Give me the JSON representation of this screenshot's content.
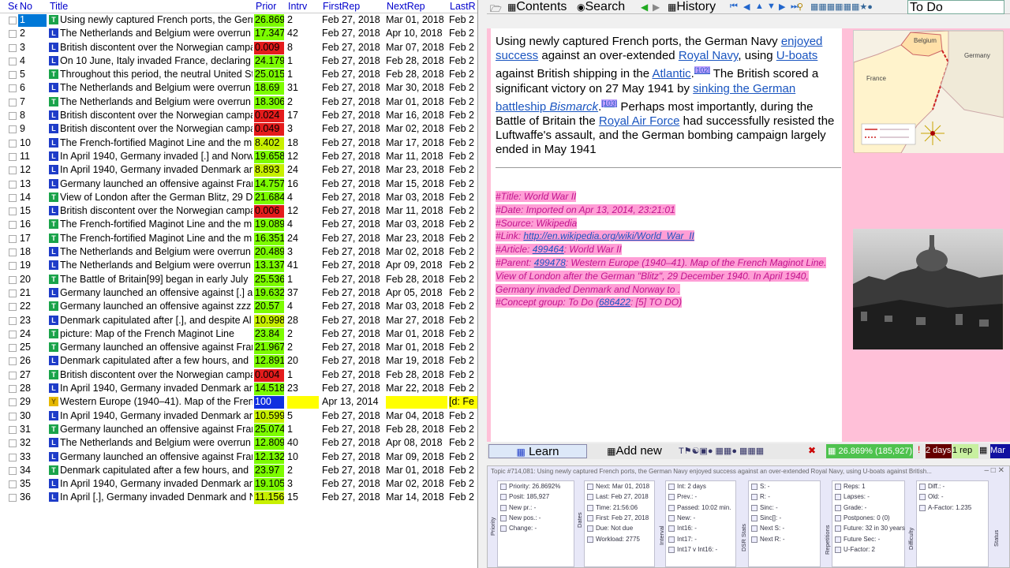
{
  "list": {
    "headers": {
      "sel": "Se",
      "no": "No",
      "title": "Title",
      "prior": "Prior",
      "intrv": "Intrv",
      "first": "FirstRep",
      "next": "NextRep",
      "last": "LastR"
    },
    "rows": [
      {
        "no": "1",
        "icon": "T",
        "title": "Using newly captured French ports, the German",
        "prior": "26.869",
        "pc": "green",
        "intrv": "2",
        "first": "Feb 27, 2018",
        "next": "Mar 01, 2018",
        "last": "Feb 2"
      },
      {
        "no": "2",
        "icon": "L",
        "title": "The Netherlands and Belgium were overrun",
        "prior": "17.347",
        "pc": "green",
        "intrv": "42",
        "first": "Feb 27, 2018",
        "next": "Apr 10, 2018",
        "last": "Feb 2"
      },
      {
        "no": "3",
        "icon": "L",
        "title": "British discontent over the Norwegian campaign",
        "prior": "0.009",
        "pc": "red",
        "intrv": "8",
        "first": "Feb 27, 2018",
        "next": "Mar 07, 2018",
        "last": "Feb 2"
      },
      {
        "no": "4",
        "icon": "L",
        "title": "On 10 June, Italy invaded France, declaring",
        "prior": "24.179",
        "pc": "green",
        "intrv": "1",
        "first": "Feb 27, 2018",
        "next": "Feb 28, 2018",
        "last": "Feb 2"
      },
      {
        "no": "5",
        "icon": "T",
        "title": "Throughout this period, the neutral United States",
        "prior": "25.015",
        "pc": "green",
        "intrv": "1",
        "first": "Feb 27, 2018",
        "next": "Feb 28, 2018",
        "last": "Feb 2"
      },
      {
        "no": "6",
        "icon": "L",
        "title": "The Netherlands and Belgium were overrun",
        "prior": "18.69",
        "pc": "green",
        "intrv": "31",
        "first": "Feb 27, 2018",
        "next": "Mar 30, 2018",
        "last": "Feb 2"
      },
      {
        "no": "7",
        "icon": "T",
        "title": "The Netherlands and Belgium were overrun",
        "prior": "18.306",
        "pc": "green",
        "intrv": "2",
        "first": "Feb 27, 2018",
        "next": "Mar 01, 2018",
        "last": "Feb 2"
      },
      {
        "no": "8",
        "icon": "L",
        "title": "British discontent over the Norwegian campaign",
        "prior": "0.024",
        "pc": "red",
        "intrv": "17",
        "first": "Feb 27, 2018",
        "next": "Mar 16, 2018",
        "last": "Feb 2"
      },
      {
        "no": "9",
        "icon": "L",
        "title": "British discontent over the Norwegian campaign",
        "prior": "0.049",
        "pc": "red",
        "intrv": "3",
        "first": "Feb 27, 2018",
        "next": "Mar 02, 2018",
        "last": "Feb 2"
      },
      {
        "no": "10",
        "icon": "L",
        "title": "The French-fortified Maginot Line and the m",
        "prior": "8.402",
        "pc": "ygreen",
        "intrv": "18",
        "first": "Feb 27, 2018",
        "next": "Mar 17, 2018",
        "last": "Feb 2"
      },
      {
        "no": "11",
        "icon": "L",
        "title": "In April 1940, Germany invaded [.] and Norway",
        "prior": "19.658",
        "pc": "green",
        "intrv": "12",
        "first": "Feb 27, 2018",
        "next": "Mar 11, 2018",
        "last": "Feb 2"
      },
      {
        "no": "12",
        "icon": "L",
        "title": "In April 1940, Germany invaded Denmark and",
        "prior": "8.893",
        "pc": "ygreen",
        "intrv": "24",
        "first": "Feb 27, 2018",
        "next": "Mar 23, 2018",
        "last": "Feb 2"
      },
      {
        "no": "13",
        "icon": "L",
        "title": "Germany launched an offensive against France",
        "prior": "14.757",
        "pc": "green",
        "intrv": "16",
        "first": "Feb 27, 2018",
        "next": "Mar 15, 2018",
        "last": "Feb 2"
      },
      {
        "no": "14",
        "icon": "T",
        "title": "View of London after the German Blitz, 29 D",
        "prior": "21.684",
        "pc": "green",
        "intrv": "4",
        "first": "Feb 27, 2018",
        "next": "Mar 03, 2018",
        "last": "Feb 2"
      },
      {
        "no": "15",
        "icon": "L",
        "title": "British discontent over the Norwegian campaign",
        "prior": "0.006",
        "pc": "red",
        "intrv": "12",
        "first": "Feb 27, 2018",
        "next": "Mar 11, 2018",
        "last": "Feb 2"
      },
      {
        "no": "16",
        "icon": "T",
        "title": "The French-fortified Maginot Line and the m",
        "prior": "19.089",
        "pc": "green",
        "intrv": "4",
        "first": "Feb 27, 2018",
        "next": "Mar 03, 2018",
        "last": "Feb 2"
      },
      {
        "no": "17",
        "icon": "T",
        "title": "The French-fortified Maginot Line and the m",
        "prior": "16.351",
        "pc": "green",
        "intrv": "24",
        "first": "Feb 27, 2018",
        "next": "Mar 23, 2018",
        "last": "Feb 2"
      },
      {
        "no": "18",
        "icon": "L",
        "title": "The Netherlands and Belgium were overrun",
        "prior": "20.489",
        "pc": "green",
        "intrv": "3",
        "first": "Feb 27, 2018",
        "next": "Mar 02, 2018",
        "last": "Feb 2"
      },
      {
        "no": "19",
        "icon": "L",
        "title": "The Netherlands and Belgium were overrun",
        "prior": "13.137",
        "pc": "green",
        "intrv": "41",
        "first": "Feb 27, 2018",
        "next": "Apr 09, 2018",
        "last": "Feb 2"
      },
      {
        "no": "20",
        "icon": "T",
        "title": "The Battle of Britain[99] began in early July",
        "prior": "25.536",
        "pc": "green",
        "intrv": "1",
        "first": "Feb 27, 2018",
        "next": "Feb 28, 2018",
        "last": "Feb 2"
      },
      {
        "no": "21",
        "icon": "L",
        "title": "Germany launched an offensive against [.] a",
        "prior": "19.632",
        "pc": "green",
        "intrv": "37",
        "first": "Feb 27, 2018",
        "next": "Apr 05, 2018",
        "last": "Feb 2"
      },
      {
        "no": "22",
        "icon": "T",
        "title": "Germany launched an offensive against zzz",
        "prior": "20.57",
        "pc": "green",
        "intrv": "4",
        "first": "Feb 27, 2018",
        "next": "Mar 03, 2018",
        "last": "Feb 2"
      },
      {
        "no": "23",
        "icon": "L",
        "title": "Denmark capitulated after [.], and despite Al",
        "prior": "10.998",
        "pc": "ygreen",
        "intrv": "28",
        "first": "Feb 27, 2018",
        "next": "Mar 27, 2018",
        "last": "Feb 2"
      },
      {
        "no": "24",
        "icon": "T",
        "title": "picture: Map of the French Maginot Line",
        "prior": "23.84",
        "pc": "green",
        "intrv": "2",
        "first": "Feb 27, 2018",
        "next": "Mar 01, 2018",
        "last": "Feb 2"
      },
      {
        "no": "25",
        "icon": "T",
        "title": "Germany launched an offensive against France",
        "prior": "21.967",
        "pc": "green",
        "intrv": "2",
        "first": "Feb 27, 2018",
        "next": "Mar 01, 2018",
        "last": "Feb 2"
      },
      {
        "no": "26",
        "icon": "L",
        "title": "Denmark capitulated after a few hours, and",
        "prior": "12.891",
        "pc": "green",
        "intrv": "20",
        "first": "Feb 27, 2018",
        "next": "Mar 19, 2018",
        "last": "Feb 2"
      },
      {
        "no": "27",
        "icon": "T",
        "title": "British discontent over the Norwegian campaign",
        "prior": "0.004",
        "pc": "red",
        "intrv": "1",
        "first": "Feb 27, 2018",
        "next": "Feb 28, 2018",
        "last": "Feb 2"
      },
      {
        "no": "28",
        "icon": "L",
        "title": "In April 1940, Germany invaded Denmark and",
        "prior": "14.518",
        "pc": "green",
        "intrv": "23",
        "first": "Feb 27, 2018",
        "next": "Mar 22, 2018",
        "last": "Feb 2"
      },
      {
        "no": "29",
        "icon": "Y",
        "title": "Western Europe (1940–41). Map of the French",
        "prior": "100",
        "pc": "blue",
        "intrv": "",
        "first": "Apr 13, 2014",
        "next": "",
        "last": "[d: Fe"
      },
      {
        "no": "30",
        "icon": "L",
        "title": "In April 1940, Germany invaded Denmark and",
        "prior": "10.599",
        "pc": "ygreen",
        "intrv": "5",
        "first": "Feb 27, 2018",
        "next": "Mar 04, 2018",
        "last": "Feb 2"
      },
      {
        "no": "31",
        "icon": "T",
        "title": "Germany launched an offensive against France",
        "prior": "25.074",
        "pc": "green",
        "intrv": "1",
        "first": "Feb 27, 2018",
        "next": "Feb 28, 2018",
        "last": "Feb 2"
      },
      {
        "no": "32",
        "icon": "L",
        "title": "The Netherlands and Belgium were overrun",
        "prior": "12.809",
        "pc": "green",
        "intrv": "40",
        "first": "Feb 27, 2018",
        "next": "Apr 08, 2018",
        "last": "Feb 2"
      },
      {
        "no": "33",
        "icon": "L",
        "title": "Germany launched an offensive against France",
        "prior": "12.132",
        "pc": "green",
        "intrv": "10",
        "first": "Feb 27, 2018",
        "next": "Mar 09, 2018",
        "last": "Feb 2"
      },
      {
        "no": "34",
        "icon": "T",
        "title": "Denmark capitulated after a few hours, and",
        "prior": "23.97",
        "pc": "green",
        "intrv": "2",
        "first": "Feb 27, 2018",
        "next": "Mar 01, 2018",
        "last": "Feb 2"
      },
      {
        "no": "35",
        "icon": "L",
        "title": "In April 1940, Germany invaded Denmark and",
        "prior": "19.105",
        "pc": "green",
        "intrv": "3",
        "first": "Feb 27, 2018",
        "next": "Mar 02, 2018",
        "last": "Feb 2"
      },
      {
        "no": "36",
        "icon": "L",
        "title": "In April [.], Germany invaded Denmark and N",
        "prior": "11.156",
        "pc": "ygreen",
        "intrv": "15",
        "first": "Feb 27, 2018",
        "next": "Mar 14, 2018",
        "last": "Feb 2"
      }
    ]
  },
  "toolbar": {
    "contents": "Contents",
    "search": "Search",
    "history": "History",
    "todo": "To Do"
  },
  "article": {
    "p1": "Using newly captured French ports, the German Navy ",
    "l1": "enjoyed success",
    "p2": " against an over-extended ",
    "l2": "Royal Navy",
    "p3": ", using ",
    "l3": "U-boats",
    "p4": " against British shipping in the ",
    "l4": "Atlantic",
    "r1": "[102]",
    "p5": " The British scored a significant victory on 27 May 1941 by ",
    "l5": "sinking the German battleship ",
    "l5b": "Bismarck",
    "r2": "[103]",
    "p6": " Perhaps most importantly, during the Battle of Britain the ",
    "l6": "Royal Air Force",
    "p7": " had successfully resisted the Luftwaffe's assault, and the German bombing campaign largely ended in May 1941"
  },
  "meta": {
    "title": "#Title: World War II",
    "date": "#Date: Imported on Apr 13, 2014, 23:21:01",
    "source": "#Source: Wikipedia",
    "link_label": "#Link: ",
    "link": "http://en.wikipedia.org/wiki/World_War_II",
    "article_label": "#Article: ",
    "article_id": "499464",
    "article_rest": ": World War II",
    "parent_label": "#Parent: ",
    "parent_id": "499478",
    "parent_rest": ": Western Europe (1940–41). Map of the French Maginot Line.",
    "parent_rest2": "View of London after the German \"Blitz\", 29 December 1940. In April 1940,",
    "parent_rest3": "Germany invaded Denmark and Norway to .",
    "concept_label": "#Concept group: To Do (",
    "concept_id": "686422",
    "concept_rest": ": [5] TO DO)"
  },
  "map": {
    "belgium": "Belgium",
    "france": "France",
    "germany": "Germany"
  },
  "learnbar": {
    "learn": "Learn",
    "addnew": "Add new",
    "priority": "26.869% (185,927)",
    "days": "2 days",
    "rep": "1 rep",
    "mar": "Mar"
  },
  "stats": {
    "title": "Topic #714,081: Using newly captured French ports, the German Navy enjoyed success against an over-extended Royal Navy, using U-boats against British...",
    "priority": [
      "Priority: 26.8692%",
      "Posit: 185,927",
      "New pr.: -",
      "New pos.: -",
      "Change: -"
    ],
    "dates": [
      "Next: Mar 01, 2018",
      "Last: Feb 27, 2018",
      "Time: 21:56:06",
      "First: Feb 27, 2018",
      "Due: Not due",
      "Workload: 2775"
    ],
    "interval": [
      "Int: 2 days",
      "Prev.: -",
      "Passed: 10:02 min.",
      "New: -",
      "Int16: -",
      "Int17: -",
      "Int17 v Int16: -"
    ],
    "dsr": [
      "S: -",
      "R: -",
      "Sinc: -",
      "Sinc[]: -",
      "Next S: -",
      "Next R: -"
    ],
    "reps": [
      "Reps: 1",
      "Lapses: -",
      "Grade: -",
      "Postpones: 0 (0)",
      "Future: 32 in 30 years",
      "Future Sec: -",
      "U-Factor: 2"
    ],
    "diff": [
      "Diff.: -",
      "Old: -",
      "A-Factor: 1.235"
    ],
    "vlabels": {
      "priority": "Priority",
      "dates": "Dates",
      "interval": "Interval",
      "dsr": "DSR Stats",
      "reps": "Repetitions",
      "diff": "Difficulty",
      "status": "Status"
    }
  }
}
